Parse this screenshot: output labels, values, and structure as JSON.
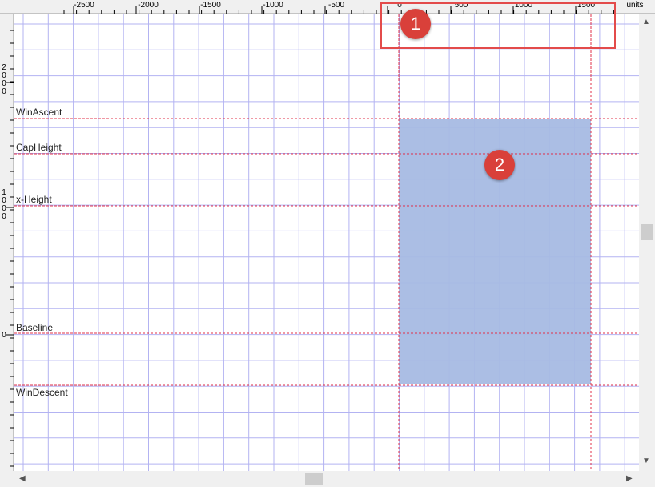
{
  "ruler": {
    "unit_label": "units",
    "x_ticks": [
      "-2500",
      "-2000",
      "-1500",
      "-1000",
      "-500",
      "0",
      "500",
      "1000",
      "1500"
    ],
    "y_ticks": [
      {
        "label": "2000",
        "chars": [
          "2",
          "0",
          "0",
          "0"
        ]
      },
      {
        "label": "1000",
        "chars": [
          "1",
          "0",
          "0",
          "0"
        ]
      },
      {
        "label": "0",
        "chars": [
          "0"
        ]
      }
    ]
  },
  "metrics": {
    "win_ascent": "WinAscent",
    "cap_height": "CapHeight",
    "x_height": "x-Height",
    "baseline": "Baseline",
    "win_descent": "WinDescent"
  },
  "glyph": {
    "fill_color": "#a6bae3",
    "advance_width_units": 1536
  },
  "callouts": [
    "1",
    "2"
  ],
  "colors": {
    "grid": "#b3b3f2",
    "metric_line": "#e0304a",
    "callout": "#d9403a",
    "highlight": "#e34b4b"
  },
  "icons": {
    "scroll_up": "▲",
    "scroll_down": "▼",
    "scroll_left": "◀",
    "scroll_right": "▶"
  }
}
